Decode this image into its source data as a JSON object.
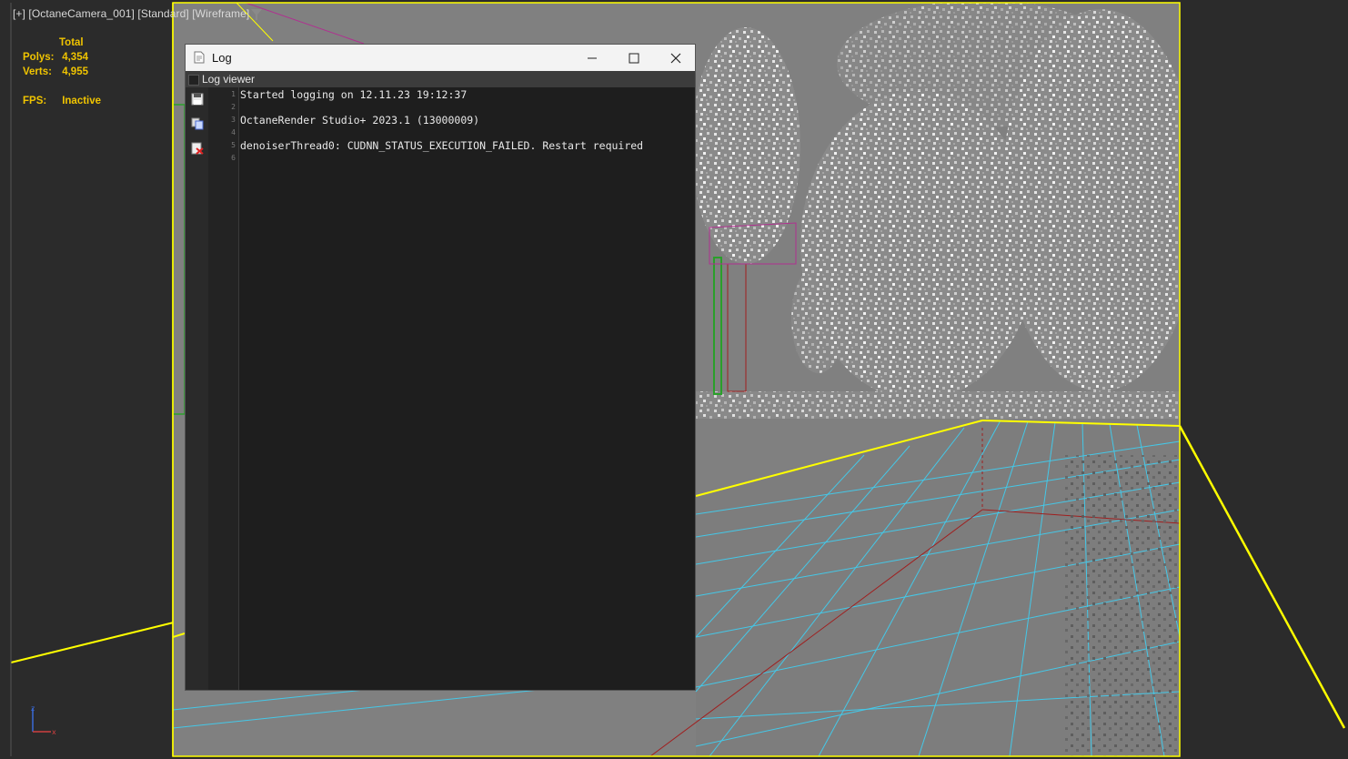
{
  "viewport": {
    "label_parts": [
      "[+]",
      "[OctaneCamera_001]",
      "[Standard]",
      "[Wireframe]"
    ],
    "stats": {
      "total_label": "Total",
      "polys_label": "Polys:",
      "polys_value": "4,354",
      "verts_label": "Verts:",
      "verts_value": "4,955",
      "fps_label": "FPS:",
      "fps_value": "Inactive"
    },
    "axis": {
      "x": "x",
      "z": "z"
    },
    "colors": {
      "selection": "#ffff00",
      "grid": "#44c8e8",
      "stats": "#f0c400"
    }
  },
  "log_window": {
    "title": "Log",
    "subheader_label": "Log viewer",
    "toolbar_icons": [
      "save-icon",
      "copy-icon",
      "clear-icon"
    ],
    "line_numbers": [
      "1",
      "2",
      "3",
      "4",
      "5",
      "6"
    ],
    "lines": [
      "Started logging on 12.11.23 19:12:37",
      "",
      "OctaneRender Studio+ 2023.1 (13000009)",
      "",
      "denoiserThread0: CUDNN_STATUS_EXECUTION_FAILED. Restart required",
      ""
    ]
  }
}
